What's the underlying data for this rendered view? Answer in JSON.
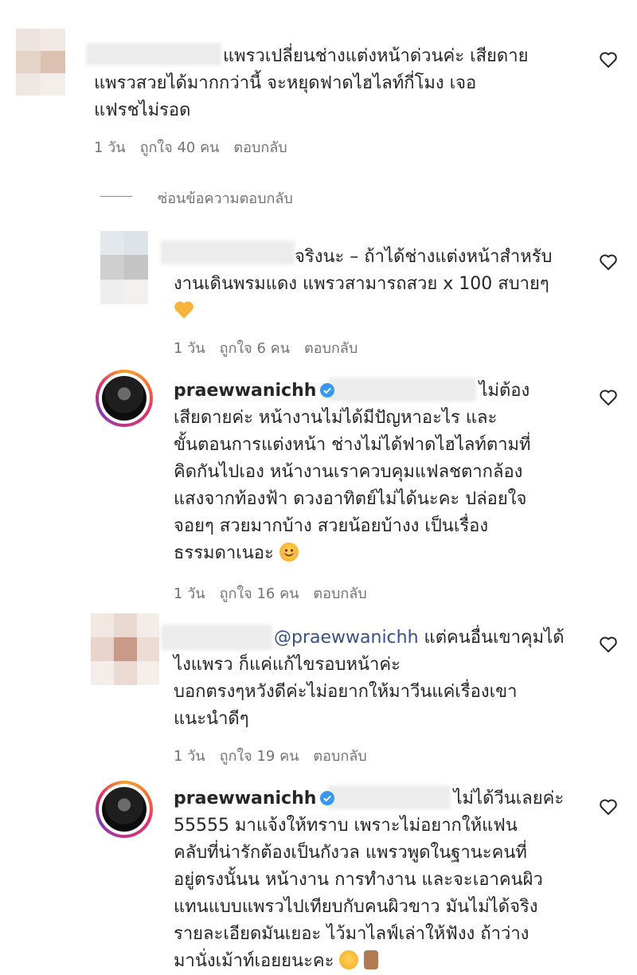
{
  "comments": [
    {
      "text_lines": [
        "แพรวเปลี่ยนช่างแต่งหน้าด่วนค่ะ เสียดาย",
        "แพรวสวยได้มากกว่านี้ จะหยุดฟาดไฮไลท์กี่โมง เจอ",
        "แฟรชไม่รอด"
      ],
      "time": "1 วัน",
      "likes": "ถูกใจ 40 คน",
      "reply_label": "ตอบกลับ"
    }
  ],
  "hide_replies_label": "ซ่อนข้อความตอบกลับ",
  "replies": [
    {
      "text_lines": [
        "จริงนะ – ถ้าได้ช่างแต่งหน้าสำหรับ",
        "งานเดินพรมแดง แพรวสามารถสวย x 100 สบายๆ"
      ],
      "time": "1 วัน",
      "likes": "ถูกใจ 6 คน",
      "reply_label": "ตอบกลับ"
    },
    {
      "username": "praewwanichh",
      "first_line_tail": "ไม่ต้อง",
      "text_lines": [
        "เสียดายค่ะ หน้างานไม่ได้มีปัญหาอะไร และ",
        "ขั้นตอนการแต่งหน้า ช่างไม่ได้ฟาดไฮไลท์ตามที่",
        "คิดกันไปเอง หน้างานเราควบคุมแฟลชตากล้อง",
        "แสงจากท้องฟ้า ดวงอาทิตย์ไม่ได้นะคะ ปล่อยใจ",
        "จอยๆ สวยมากบ้าง สวยน้อยบ้างง เป็นเรื่อง",
        "ธรรมดาเนอะ"
      ],
      "time": "1 วัน",
      "likes": "ถูกใจ 16 คน",
      "reply_label": "ตอบกลับ"
    },
    {
      "mention": "@praewwanichh",
      "first_line_tail": "แต่คนอื่นเขาคุมได้",
      "text_lines": [
        "ไงแพรว ก็แค่แก้ไขรอบหน้าค่ะ",
        "บอกตรงๆหวังดีค่ะไม่อยากให้มาวีนแค่เรื่องเขา",
        "แนะนำดีๆ"
      ],
      "time": "1 วัน",
      "likes": "ถูกใจ 19 คน",
      "reply_label": "ตอบกลับ"
    },
    {
      "username": "praewwanichh",
      "first_line_tail": "ไม่ได้วีนเลยค่ะ",
      "text_lines": [
        "55555 มาแจ้งให้ทราบ เพราะไม่อยากให้แฟน",
        "คลับที่น่ารักต้องเป็นกังวล แพรวพูดในฐานะคนที่",
        "อยู่ตรงนั้นน หน้างาน การทำงาน และจะเอาคนผิว",
        "แทนแบบแพรวไปเทียบกับคนผิวขาว มันไม่ได้จริง",
        "รายละเอียดมันเยอะ ไว้มาไลฟ์เล่าให้ฟังง ถ้าว่าง",
        "มานั่งเม้าท์เอยยนะคะ"
      ]
    }
  ]
}
